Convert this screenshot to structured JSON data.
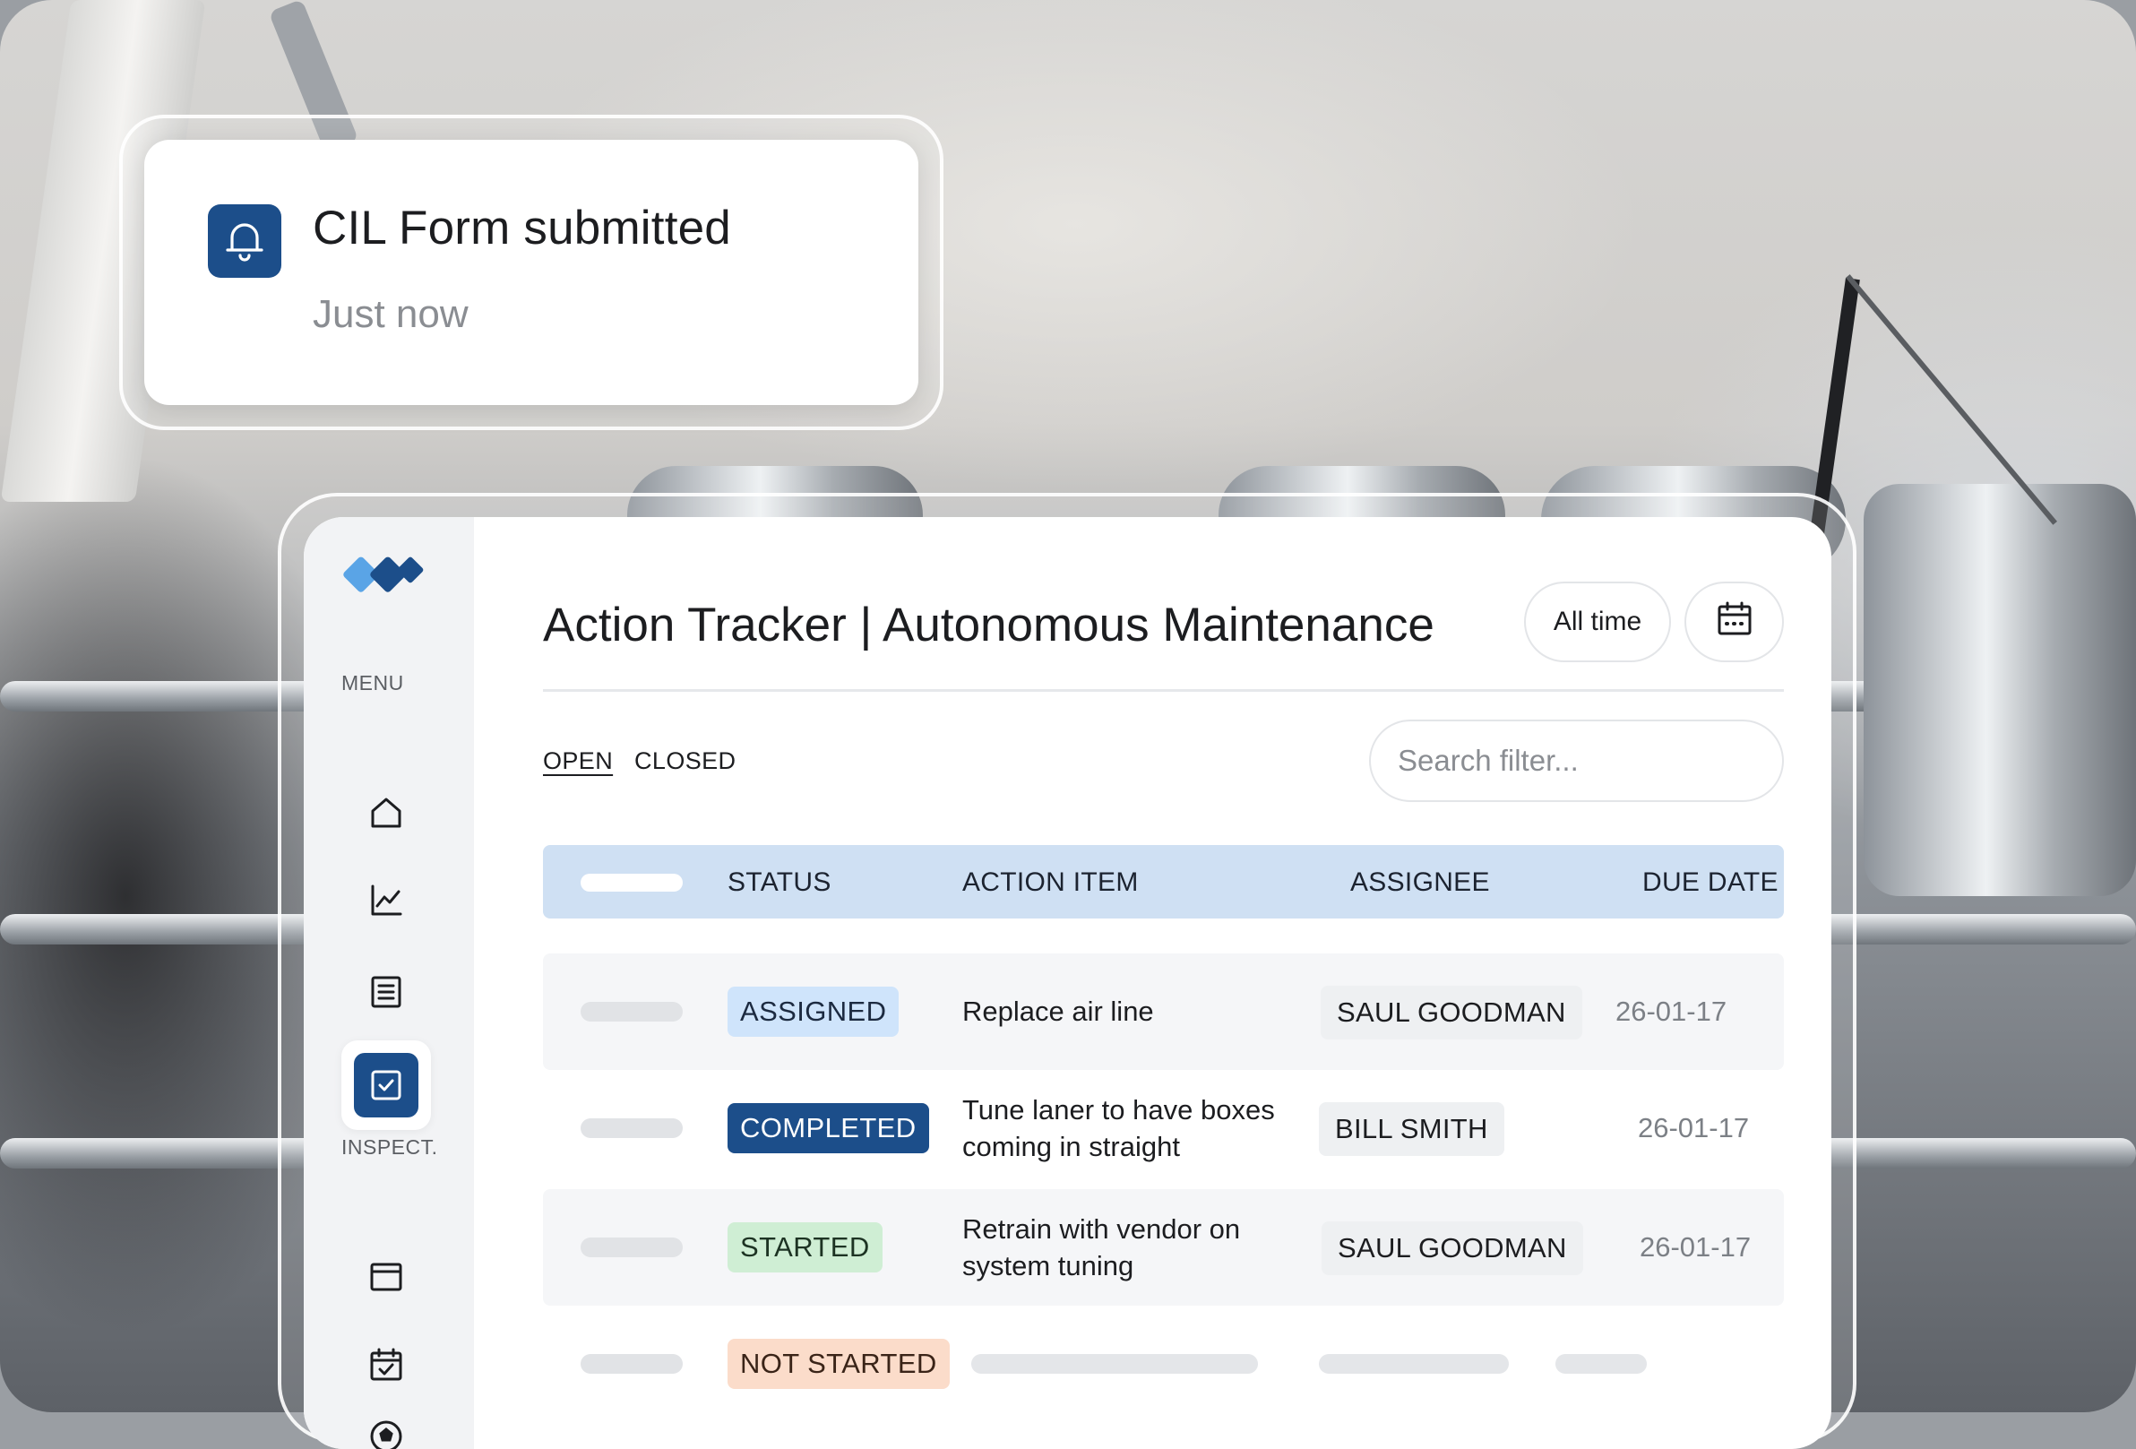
{
  "notification": {
    "title": "CIL Form submitted",
    "time": "Just now",
    "icon": "bell-icon"
  },
  "sidebar": {
    "logo": "app-logo",
    "menu_label": "MENU",
    "menu_items": [
      {
        "icon": "home-icon",
        "active": false
      },
      {
        "icon": "chart-line-icon",
        "active": false
      },
      {
        "icon": "document-list-icon",
        "active": false
      },
      {
        "icon": "checkbox-icon",
        "active": true
      }
    ],
    "inspect_label": "INSPECT.",
    "inspect_items": [
      {
        "icon": "browser-window-icon"
      },
      {
        "icon": "calendar-check-icon"
      },
      {
        "icon": "soccer-ball-icon"
      }
    ]
  },
  "header": {
    "title": "Action Tracker | Autonomous Maintenance",
    "time_filter": "All time",
    "calendar_icon": "calendar-icon"
  },
  "tabs": [
    {
      "label": "OPEN",
      "active": true
    },
    {
      "label": "CLOSED",
      "active": false
    }
  ],
  "search": {
    "placeholder": "Search filter..."
  },
  "table": {
    "columns": [
      "STATUS",
      "ACTION ITEM",
      "ASSIGNEE",
      "DUE DATE"
    ],
    "rows": [
      {
        "status": "ASSIGNED",
        "action": "Replace air line",
        "assignee": "SAUL GOODMAN",
        "due": "26-01-17"
      },
      {
        "status": "COMPLETED",
        "action": "Tune laner to have boxes coming in straight",
        "assignee": "BILL SMITH",
        "due": "26-01-17"
      },
      {
        "status": "STARTED",
        "action": "Retrain with vendor on system tuning",
        "assignee": "SAUL GOODMAN",
        "due": "26-01-17"
      },
      {
        "status": "NOT STARTED",
        "action": "",
        "assignee": "",
        "due": ""
      }
    ]
  },
  "colors": {
    "brand": "#1c4e8a",
    "header_row": "#cfe0f3",
    "assigned_bg": "#cfe4fb",
    "assigned_fg": "#1c2a40",
    "completed_bg": "#1c4e8a",
    "completed_fg": "#ffffff",
    "started_bg": "#cfeed4",
    "started_fg": "#1d3323",
    "not_started_bg": "#fbdcca",
    "not_started_fg": "#3a2418"
  }
}
